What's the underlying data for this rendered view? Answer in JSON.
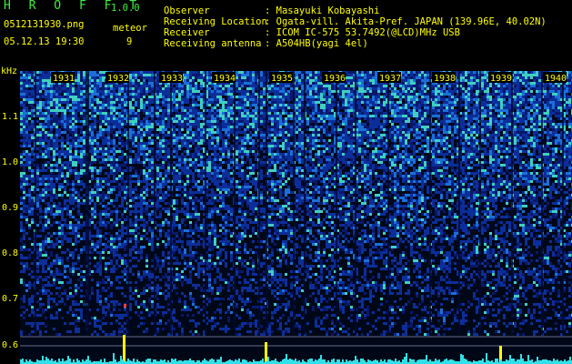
{
  "app": {
    "title": "H R O F F T",
    "version": "1.0.0"
  },
  "file": {
    "name": "0512131930.png",
    "datetime": "05.12.13 19:30"
  },
  "meteor": {
    "label": "meteor",
    "count": "9"
  },
  "info": [
    {
      "label": "Observer",
      "value": ": Masayuki Kobayashi"
    },
    {
      "label": "Receiving Location",
      "value": ": Ogata-vill. Akita-Pref. JAPAN (139.96E, 40.02N)"
    },
    {
      "label": "Receiver",
      "value": ": ICOM IC-575 53.7492(@LCD)MHz USB"
    },
    {
      "label": "Receiving antenna",
      "value": ": A504HB(yagi 4el)"
    }
  ],
  "axis": {
    "unit": "kHz",
    "ticks": [
      {
        "label": "1.1",
        "value": 1.1
      },
      {
        "label": "1.0",
        "value": 1.0
      },
      {
        "label": "0.9",
        "value": 0.9
      },
      {
        "label": "0.8",
        "value": 0.8
      },
      {
        "label": "0.7",
        "value": 0.7
      },
      {
        "label": "0.6",
        "value": 0.6
      }
    ]
  },
  "time_labels": [
    "1931",
    "1932",
    "1933",
    "1934",
    "1935",
    "1936",
    "1937",
    "1938",
    "1939",
    "1940"
  ],
  "colors": {
    "accent": "#3cf03c",
    "text": "#ffff00",
    "background": "#000000"
  }
}
